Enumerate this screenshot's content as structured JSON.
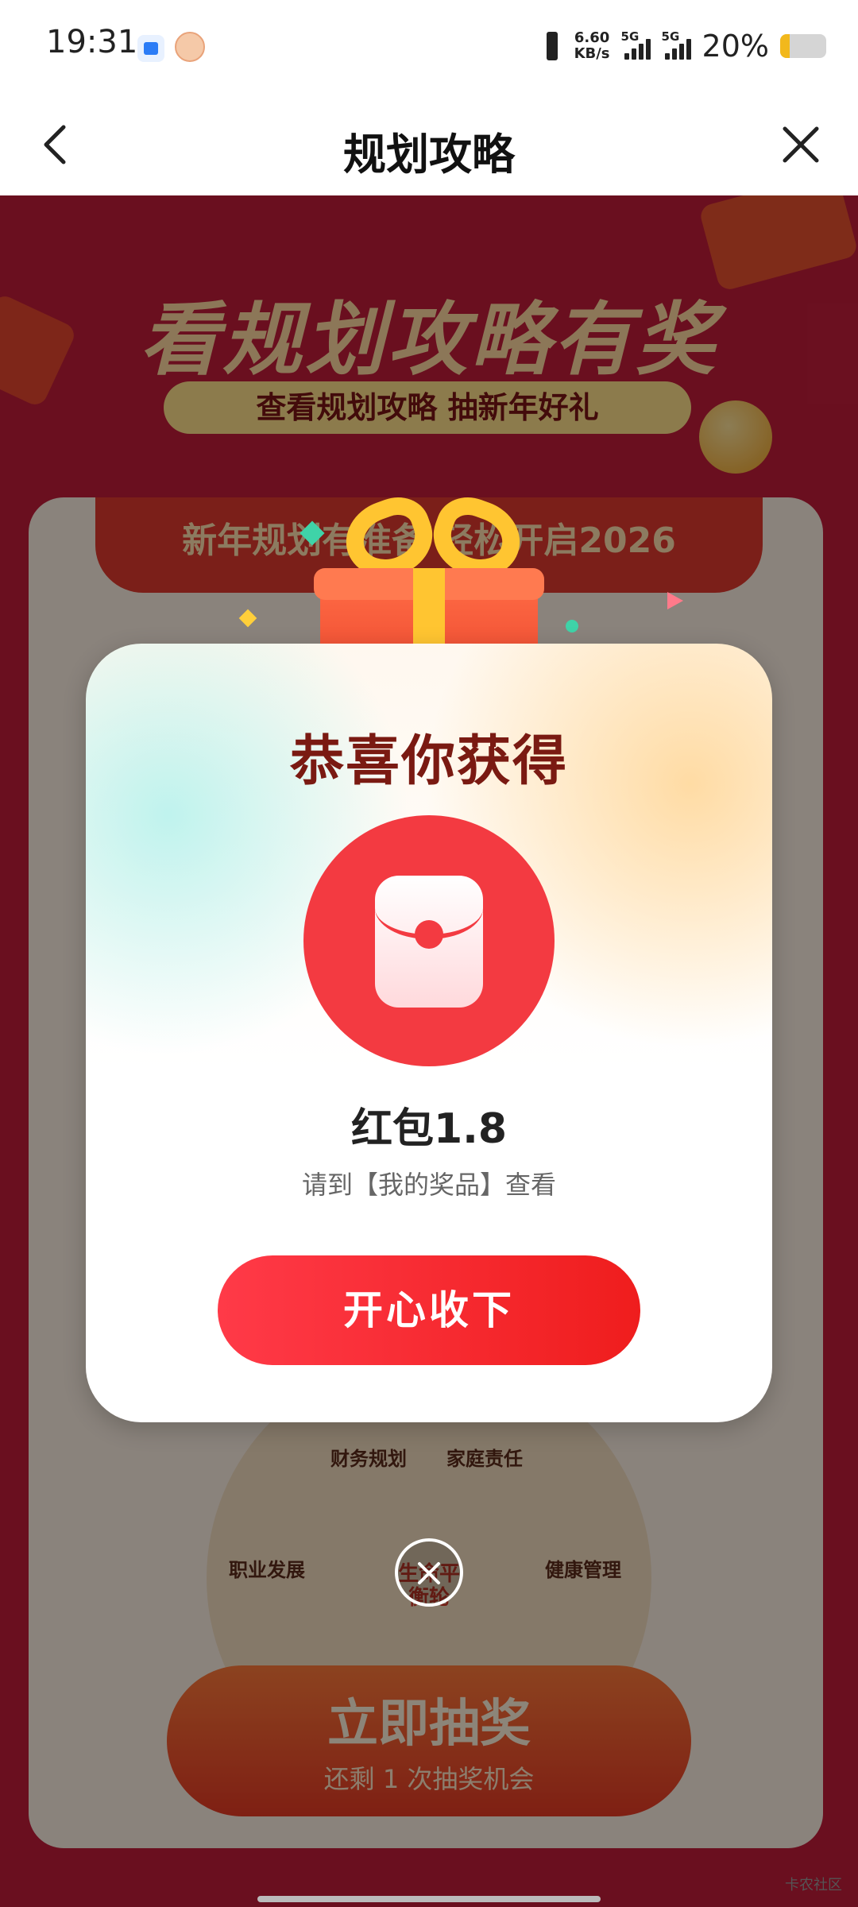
{
  "status_bar": {
    "time": "19:31",
    "net_speed_value": "6.60",
    "net_speed_unit": "KB/s",
    "sim1": "5G",
    "sim2": "5G",
    "battery": "20%",
    "battery_level": 0.2,
    "icons": [
      "notification-app-icon",
      "mascot-app-icon",
      "vibrate-icon",
      "signal-icon",
      "battery-icon"
    ]
  },
  "nav": {
    "title": "规划攻略",
    "back_icon": "chevron-left-icon",
    "close_icon": "close-icon"
  },
  "page": {
    "heading": "看规划攻略有奖",
    "subheading": "查看规划攻略 抽新年好礼",
    "banner": "新年规划有准备 轻松开启2026",
    "wheel": {
      "labels": [
        "财务规划",
        "家庭责任",
        "职业发展",
        "健康管理"
      ],
      "center": "生命平衡轮"
    },
    "lottery_button": {
      "label": "立即抽奖",
      "remaining": "还剩 1 次抽奖机会"
    }
  },
  "modal": {
    "title": "恭喜你获得",
    "prize_icon": "red-envelope-icon",
    "prize_name": "红包1.8",
    "hint": "请到【我的奖品】查看",
    "accept_label": "开心收下"
  },
  "watermark": "卡农社区",
  "colors": {
    "accent_red": "#f33a41",
    "title_brown": "#7a1a12",
    "page_red": "#c21d3a",
    "battery_yellow": "#f2b81c"
  }
}
